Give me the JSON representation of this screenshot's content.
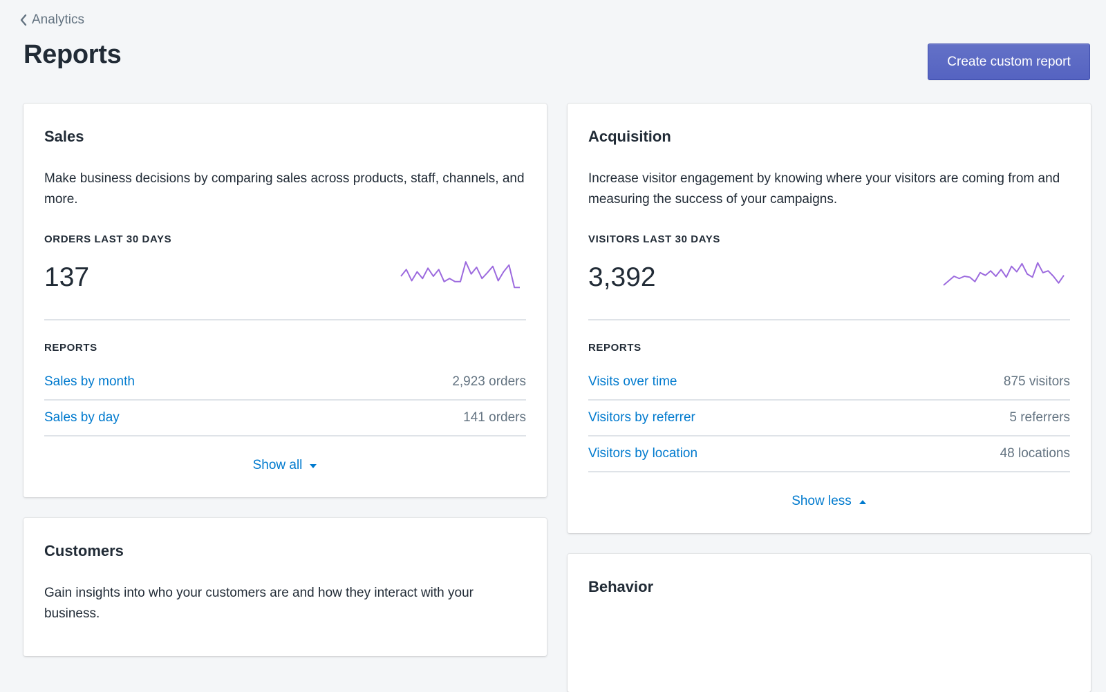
{
  "breadcrumb": {
    "label": "Analytics",
    "icon": "chevron-left-icon"
  },
  "page": {
    "title": "Reports"
  },
  "header": {
    "create_button": "Create custom report"
  },
  "colors": {
    "primary": "#5c6ac4",
    "link": "#007ace",
    "sparkline": "#9c6ade"
  },
  "sales": {
    "title": "Sales",
    "description": "Make business decisions by comparing sales across products, staff, channels, and more.",
    "metric_label": "ORDERS LAST 30 DAYS",
    "metric_value": "137",
    "sparkline": [
      40,
      55,
      30,
      50,
      35,
      58,
      40,
      55,
      28,
      35,
      28,
      28,
      72,
      45,
      60,
      35,
      48,
      62,
      30,
      50,
      65,
      15,
      15
    ],
    "reports_label": "REPORTS",
    "reports": [
      {
        "name": "Sales by month",
        "count": "2,923 orders"
      },
      {
        "name": "Sales by day",
        "count": "141 orders"
      }
    ],
    "toggle_label": "Show all",
    "toggle_icon": "caret-down-icon"
  },
  "acquisition": {
    "title": "Acquisition",
    "description": "Increase visitor engagement by knowing where your visitors are coming from and measuring the success of your campaigns.",
    "metric_label": "VISITORS LAST 30 DAYS",
    "metric_value": "3,392",
    "sparkline": [
      20,
      30,
      40,
      35,
      40,
      38,
      28,
      48,
      42,
      52,
      40,
      55,
      38,
      62,
      50,
      68,
      45,
      38,
      70,
      48,
      52,
      40,
      25,
      42
    ],
    "reports_label": "REPORTS",
    "reports": [
      {
        "name": "Visits over time",
        "count": "875 visitors"
      },
      {
        "name": "Visitors by referrer",
        "count": "5 referrers"
      },
      {
        "name": "Visitors by location",
        "count": "48 locations"
      }
    ],
    "toggle_label": "Show less",
    "toggle_icon": "caret-up-icon"
  },
  "customers": {
    "title": "Customers",
    "description": "Gain insights into who your customers are and how they interact with your business."
  },
  "behavior": {
    "title": "Behavior"
  }
}
